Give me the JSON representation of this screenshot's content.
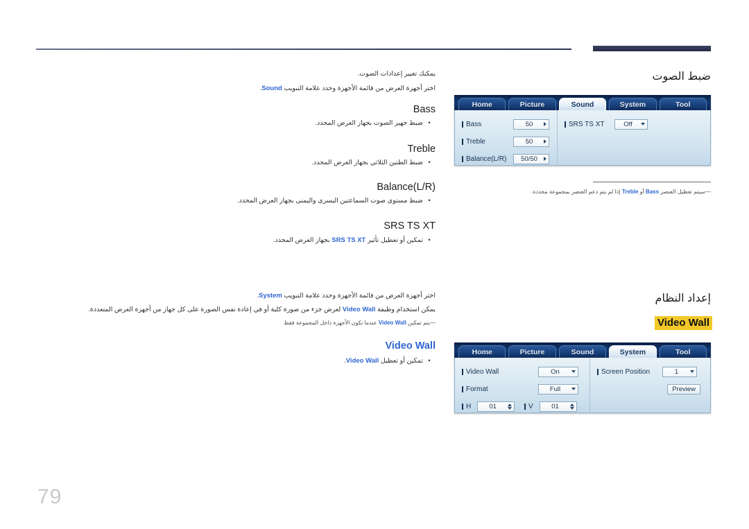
{
  "page": {
    "number": "79",
    "language": "ar"
  },
  "sound_section": {
    "heading": "ضبط الصوت",
    "intro_line1": "يمكنك تغيير إعدادات الصوت.",
    "intro_line2_prefix": "اختر أجهزة العرض من قائمة الأجهزة وحدد علامة التبويب ",
    "intro_line2_keyword": "Sound",
    "intro_line2_suffix": ".",
    "items": [
      {
        "title": "Bass",
        "desc": "ضبط جهير الصوت بجهاز العرض المحدد."
      },
      {
        "title": "Treble",
        "desc": "ضبط الطنين الثلاثي بجهاز العرض المحدد."
      },
      {
        "title": "Balance(L/R)",
        "desc": "ضبط مستوى صوت السماعتين اليسرى واليمنى بجهاز العرض المحدد."
      },
      {
        "title": "SRS TS XT",
        "desc_prefix": "تمكين أو تعطيل تأثير ",
        "desc_keyword": "SRS TS XT",
        "desc_suffix": " بجهاز العرض المحدد."
      }
    ],
    "note": {
      "prefix": "سيتم تعطيل العنصر ",
      "keyword1": "Bass",
      "middle": " أو ",
      "keyword2": "Treble",
      "suffix": " إذا لم يتم دعم العنصر بمجموعة محددة."
    },
    "osd": {
      "tabs": [
        "Home",
        "Picture",
        "Sound",
        "System",
        "Tool"
      ],
      "active_tab": "Sound",
      "left_rows": [
        {
          "label": "Bass",
          "value": "50",
          "control": "arrow-right"
        },
        {
          "label": "Treble",
          "value": "50",
          "control": "arrow-right"
        },
        {
          "label": "Balance(L/R)",
          "value": "50/50",
          "control": "arrow-right"
        }
      ],
      "right_rows": [
        {
          "label": "SRS TS XT",
          "value": "Off",
          "control": "dropdown"
        }
      ]
    }
  },
  "system_section": {
    "heading": "إعداد النظام",
    "highlight": "Video Wall",
    "intro_line1_prefix": "اختر أجهزة العرض من قائمة الأجهزة وحدد علامة التبويب ",
    "intro_line1_keyword": "System",
    "intro_line1_suffix": ".",
    "intro_line2_prefix": "يمكن استخدام وظيفة ",
    "intro_line2_keyword": "Video Wall",
    "intro_line2_suffix": " لعرض جزء من صورة كلية أو في إعادة نفس الصورة على كل جهاز من أجهزة العرض المتعددة.",
    "note": {
      "prefix": "يتم تمكين ",
      "keyword": "Video Wall",
      "suffix": " عندما تكون الأجهزة داخل المجموعة فقط"
    },
    "items": [
      {
        "title": "Video Wall",
        "desc_prefix": "تمكين أو تعطيل ",
        "desc_keyword": "Video Wall",
        "desc_suffix": "."
      }
    ],
    "osd": {
      "tabs": [
        "Home",
        "Picture",
        "Sound",
        "System",
        "Tool"
      ],
      "active_tab": "System",
      "left_rows": [
        {
          "label": "Video Wall",
          "value": "On",
          "control": "dropdown"
        },
        {
          "label": "Format",
          "value": "Full",
          "control": "dropdown"
        }
      ],
      "hv_rows": [
        {
          "label": "H",
          "value": "01",
          "control": "spinner"
        },
        {
          "label": "V",
          "value": "01",
          "control": "spinner"
        }
      ],
      "right_rows": [
        {
          "label": "Screen Position",
          "value": "1",
          "control": "dropdown"
        }
      ],
      "preview_button": "Preview"
    }
  },
  "colors": {
    "keyword_blue": "#2f66d0",
    "highlight_yellow": "#f2c828",
    "header_navy": "#2e3654",
    "page_number_gray": "#c9c9c9"
  }
}
